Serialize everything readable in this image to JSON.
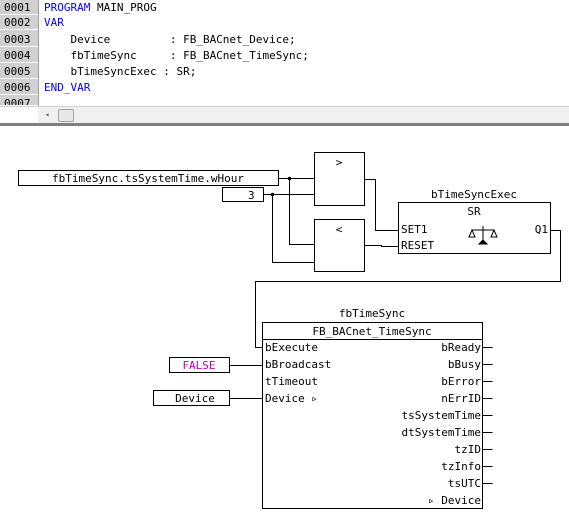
{
  "decl": {
    "lines": [
      {
        "num": "0001",
        "kw": "PROGRAM",
        "rest": " MAIN_PROG"
      },
      {
        "num": "0002",
        "kw": "VAR",
        "rest": ""
      },
      {
        "num": "0003",
        "kw": "",
        "rest": "    Device         : FB_BACnet_Device;"
      },
      {
        "num": "0004",
        "kw": "",
        "rest": "    fbTimeSync     : FB_BACnet_TimeSync;"
      },
      {
        "num": "0005",
        "kw": "",
        "rest": "    bTimeSyncExec : SR;"
      },
      {
        "num": "0006",
        "kw": "END_VAR",
        "rest": ""
      },
      {
        "num": "0007",
        "kw": "",
        "rest": ""
      }
    ],
    "keyword_color": "#0000ff"
  },
  "scroll": {
    "left_arrow": "◂"
  },
  "fbd": {
    "input_var": "fbTimeSync.tsSystemTime.wHour",
    "const3": "3",
    "gt_label": ">",
    "lt_label": "<",
    "sr": {
      "instance": "bTimeSyncExec",
      "type": "SR",
      "in1": "SET1",
      "in2": "RESET",
      "out": "Q1"
    },
    "fb": {
      "instance": "fbTimeSync",
      "type": "FB_BACnet_TimeSync",
      "inputs": [
        "bExecute",
        "bBroadcast",
        "tTimeout",
        "Device ▹"
      ],
      "outputs": [
        "bReady",
        "bBusy",
        "bError",
        "nErrID",
        "tsSystemTime",
        "dtSystemTime",
        "tzID",
        "tzInfo",
        "tsUTC",
        "▹ Device"
      ]
    },
    "false_const": "FALSE",
    "false_color": "#c000c0",
    "device_var": "Device"
  }
}
